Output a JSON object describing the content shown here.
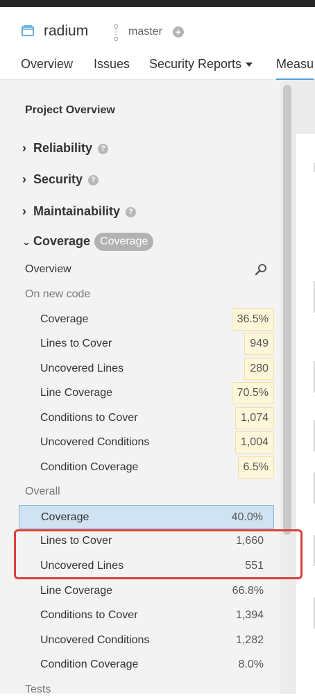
{
  "header": {
    "project_name": "radium",
    "branch_name": "master",
    "tabs": [
      "Overview",
      "Issues",
      "Security Reports",
      "Measu"
    ]
  },
  "sidebar": {
    "title": "Project Overview",
    "domains": [
      {
        "label": "Reliability",
        "expanded": false
      },
      {
        "label": "Security",
        "expanded": false
      },
      {
        "label": "Maintainability",
        "expanded": false
      },
      {
        "label": "Coverage",
        "expanded": true,
        "badge": "Coverage"
      }
    ],
    "overview_label": "Overview",
    "new_code": {
      "label": "On new code",
      "rows": [
        {
          "label": "Coverage",
          "value": "36.5%"
        },
        {
          "label": "Lines to Cover",
          "value": "949"
        },
        {
          "label": "Uncovered Lines",
          "value": "280"
        },
        {
          "label": "Line Coverage",
          "value": "70.5%"
        },
        {
          "label": "Conditions to Cover",
          "value": "1,074"
        },
        {
          "label": "Uncovered Conditions",
          "value": "1,004"
        },
        {
          "label": "Condition Coverage",
          "value": "6.5%"
        }
      ]
    },
    "overall": {
      "label": "Overall",
      "rows": [
        {
          "label": "Coverage",
          "value": "40.0%"
        },
        {
          "label": "Lines to Cover",
          "value": "1,660"
        },
        {
          "label": "Uncovered Lines",
          "value": "551"
        },
        {
          "label": "Line Coverage",
          "value": "66.8%"
        },
        {
          "label": "Conditions to Cover",
          "value": "1,394"
        },
        {
          "label": "Uncovered Conditions",
          "value": "1,282"
        },
        {
          "label": "Condition Coverage",
          "value": "8.0%"
        }
      ]
    },
    "tests_label": "Tests"
  },
  "icons": {
    "project": "project-icon",
    "branch": "branch-icon",
    "add": "plus-circle-icon",
    "help": "question-circle-icon",
    "search": "search-icon"
  },
  "colors": {
    "accent": "#4b9fd5",
    "new_code_bg": "#fdf6d8",
    "selected_bg": "#cfe3f2",
    "annotation": "#d9403b"
  }
}
